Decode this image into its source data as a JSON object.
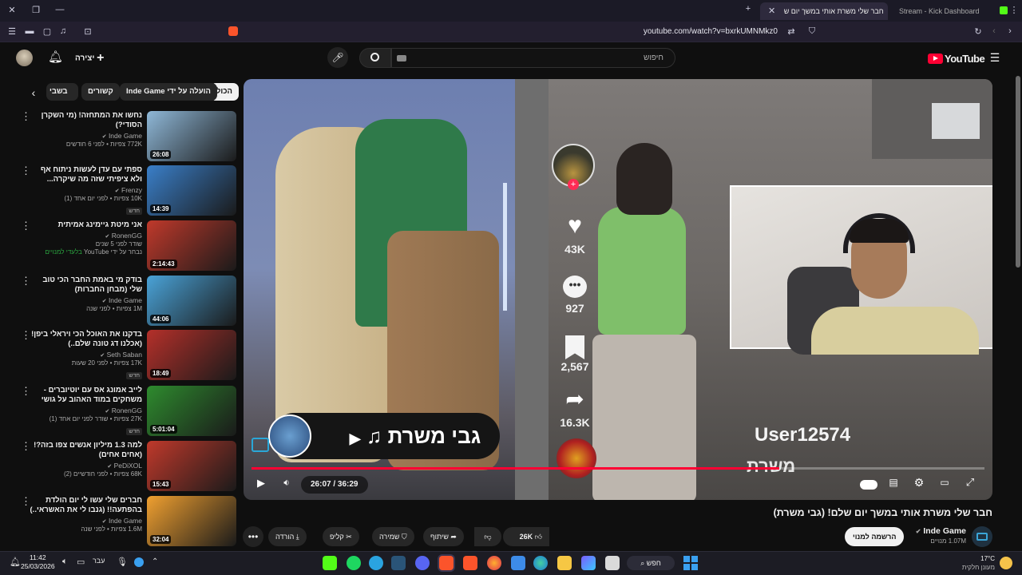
{
  "browser": {
    "tabs": [
      {
        "label": "חבר שלי משרת אותי במשך יום ש",
        "active": true
      },
      {
        "label": "Stream - Kick Dashboard",
        "active": false
      }
    ],
    "url": "youtube.com/watch?v=bxrkUMNMkz0"
  },
  "youtube": {
    "logo": "YouTube",
    "create_label": "יצירה",
    "search_placeholder": "חיפוש"
  },
  "chips": [
    {
      "label": "הכול",
      "selected": true
    },
    {
      "label": "הועלה על ידי Inde Game",
      "selected": false
    },
    {
      "label": "קשורים",
      "selected": false
    },
    {
      "label": "בשבי",
      "selected": false
    }
  ],
  "sidebar": {
    "items": [
      {
        "title": "נחשו את המתחזה! (מי השקרן הסודי?)",
        "channel": "Inde Game",
        "views": "772K צפיות • לפני 6 חודשים",
        "duration": "26:08",
        "badge": "",
        "color": "#8fb8d8"
      },
      {
        "title": "ספתי עם עדן לעשות ניתוח אף ולא ציפיתי שזה מה שיקרה...",
        "channel": "Frenzy",
        "views": "10K צפיות • לפני יום אחד (1)",
        "duration": "14:39",
        "badge": "חדש",
        "color": "#3a7fc9"
      },
      {
        "title": "אני מיטת גיימינג אמיתית",
        "channel": "RonenGG",
        "views": "שודר לפני 5 שנים",
        "duration": "2:14:43",
        "badge": "",
        "extra": "נבחר על ידי YouTube",
        "extra2": "בלעדי למנויים",
        "color": "#c0392b"
      },
      {
        "title": "בודק מי באמת החבר הכי טוב שלי (מבחן החברות)",
        "channel": "Inde Game",
        "views": "1M צפיות • לפני שנה",
        "duration": "44:06",
        "badge": "",
        "color": "#4aa3d8"
      },
      {
        "title": "בדקנו את האוכל הכי ויראלי ביפן! (אכלנו דג טונה שלם..)",
        "channel": "Seth Saban",
        "views": "17K צפיות • לפני 20 שעות",
        "duration": "18:49",
        "badge": "חדש",
        "color": "#b5302a"
      },
      {
        "title": "לייב אמונג אס עם יוטיוברים - משחקים במוד האהוב על גושי",
        "channel": "RonenGG",
        "views": "27K צפיות • שודר לפני יום אחד (1)",
        "duration": "5:01:04",
        "badge": "חדש",
        "color": "#2e8b2e"
      },
      {
        "title": "למה 1.3 מיליון אנשים צפו בזה?! (אחים אחים)",
        "channel": "PeDiXOL",
        "views": "68K צפיות • לפני חודשיים (2)",
        "duration": "15:43",
        "badge": "",
        "color": "#c0392b"
      },
      {
        "title": "חברים שלי עשו לי יום הולדת בהפתעה!! (גנבו לי את האשראי..)",
        "channel": "Inde Game",
        "views": "1.6M צפיות • לפני שנה",
        "duration": "32:04",
        "badge": "",
        "color": "#f0a030"
      }
    ]
  },
  "player": {
    "time": "26:07 / 36:29",
    "progress_fraction": 0.72,
    "overlay_name": "גבי משרת",
    "overlay_user": "User12574",
    "overlay_user_sub": "משרת",
    "tiktok": {
      "likes": "43K",
      "comments": "927",
      "saves": "2,567",
      "shares": "16.3K"
    }
  },
  "video": {
    "title": "חבר שלי משרת אותי במשך יום שלם! (גבי משרת)",
    "channel": "Inde Game",
    "subscribers": "1.07M מנויים",
    "subscribe_label": "הרשמה למנוי",
    "likes": "26K",
    "share_label": "שיתוף",
    "save_label": "שמירה",
    "clip_label": "קליפ",
    "download_label": "הורדה"
  },
  "taskbar": {
    "time": "11:42",
    "date": "25/03/2026",
    "lang": "עבר",
    "weather_temp": "17°C",
    "weather_desc": "מעונן חלקית",
    "search_label": "חפש"
  },
  "colors": {
    "accent_red": "#ff0033",
    "brand_purple": "#2e2a3d"
  }
}
